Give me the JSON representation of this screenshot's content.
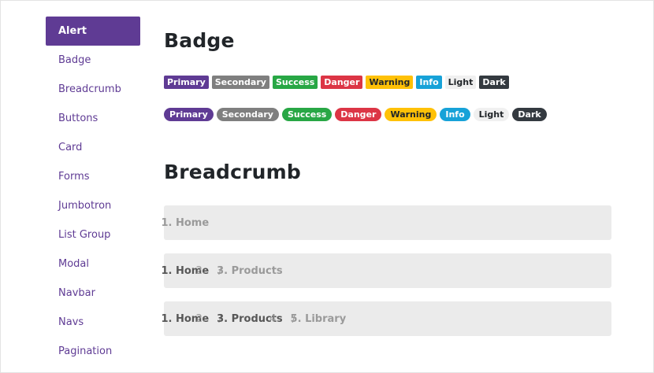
{
  "sidebar": {
    "items": [
      {
        "label": "Alert",
        "active": true
      },
      {
        "label": "Badge"
      },
      {
        "label": "Breadcrumb"
      },
      {
        "label": "Buttons"
      },
      {
        "label": "Card"
      },
      {
        "label": "Forms"
      },
      {
        "label": "Jumbotron"
      },
      {
        "label": "List Group"
      },
      {
        "label": "Modal"
      },
      {
        "label": "Navbar"
      },
      {
        "label": "Navs"
      },
      {
        "label": "Pagination"
      }
    ]
  },
  "badge_section": {
    "title": "Badge",
    "badges": [
      {
        "label": "Primary",
        "bg": "#5f3b94",
        "fg": "#ffffff"
      },
      {
        "label": "Secondary",
        "bg": "#7f7f7f",
        "fg": "#ffffff"
      },
      {
        "label": "Success",
        "bg": "#28a745",
        "fg": "#ffffff"
      },
      {
        "label": "Danger",
        "bg": "#dc3545",
        "fg": "#ffffff"
      },
      {
        "label": "Warning",
        "bg": "#ffc107",
        "fg": "#212529"
      },
      {
        "label": "Info",
        "bg": "#17a2d8",
        "fg": "#ffffff"
      },
      {
        "label": "Light",
        "bg": "#f0f0f0",
        "fg": "#212529"
      },
      {
        "label": "Dark",
        "bg": "#343a40",
        "fg": "#ffffff"
      }
    ]
  },
  "breadcrumb_section": {
    "title": "Breadcrumb",
    "separator": "/",
    "crumbs": [
      {
        "links": [],
        "current": "Home"
      },
      {
        "links": [
          "Home"
        ],
        "current": "Products"
      },
      {
        "links": [
          "Home",
          "Products"
        ],
        "current": "Library"
      }
    ]
  },
  "colors": {
    "accent": "#5f3b94",
    "breadcrumb_bg": "#ebebeb"
  }
}
